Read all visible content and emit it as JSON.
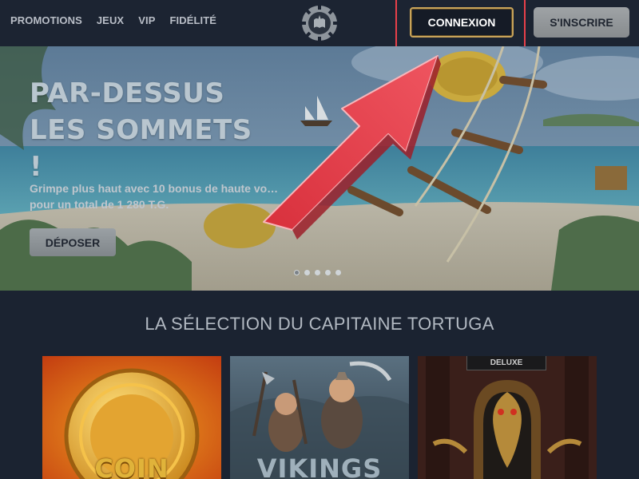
{
  "header": {
    "nav": [
      "PROMOTIONS",
      "JEUX",
      "VIP",
      "FIDÉLITÉ"
    ],
    "login_label": "CONNEXION",
    "signup_label": "S'INSCRIRE"
  },
  "hero": {
    "title": "PAR-DESSUS LES SOMMETS !",
    "subtitle": "Grimpe plus haut avec 10 bonus de haute vo… pour un total de 1 280 T.G.",
    "deposit_label": "DÉPOSER",
    "slides_total": 5,
    "active_slide": 1
  },
  "section": {
    "title": "LA SÉLECTION DU CAPITAINE TORTUGA",
    "games": [
      {
        "name": "COIN"
      },
      {
        "name": "VIKINGS"
      },
      {
        "name": "",
        "badge": "DELUXE"
      }
    ]
  },
  "colors": {
    "accent_gold": "#c9a45a",
    "highlight_red": "#e8404a",
    "header_bg": "#1c2432"
  },
  "icons": [
    "logo-emblem-icon",
    "annotation-arrow-icon"
  ]
}
